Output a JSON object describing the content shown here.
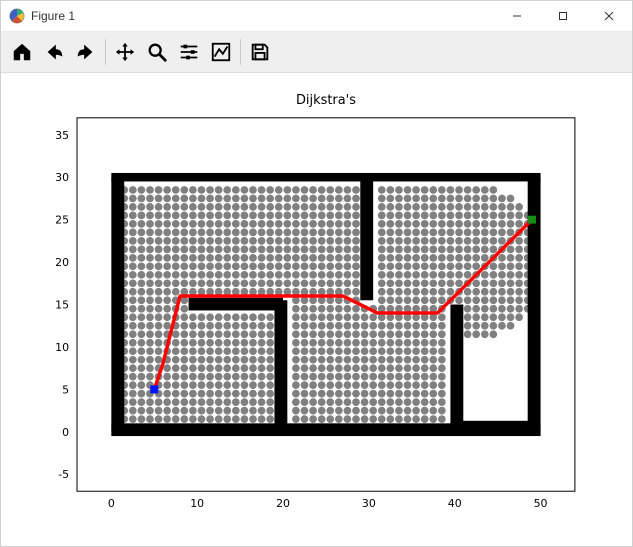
{
  "window": {
    "title": "Figure 1"
  },
  "toolbar": {
    "home_tip": "Home",
    "back_tip": "Back",
    "forward_tip": "Forward",
    "pan_tip": "Pan",
    "zoom_tip": "Zoom",
    "subplots_tip": "Configure subplots",
    "axes_tip": "Edit axis",
    "save_tip": "Save"
  },
  "chart_data": {
    "type": "scatter",
    "title": "Dijkstra's",
    "xlabel": "",
    "ylabel": "",
    "xlim": [
      -4,
      54
    ],
    "ylim": [
      -7,
      37
    ],
    "xticks": [
      0,
      10,
      20,
      30,
      40,
      50
    ],
    "yticks": [
      -5,
      0,
      5,
      10,
      15,
      20,
      25,
      30,
      35
    ],
    "obstacles_color": "#000000",
    "obstacles_rects": [
      {
        "x": 0,
        "y": -0.5,
        "w": 50,
        "h": 1.5
      },
      {
        "x": 0,
        "y": 29.5,
        "w": 50,
        "h": 1
      },
      {
        "x": 0,
        "y": 0,
        "w": 1.5,
        "h": 30
      },
      {
        "x": 48.5,
        "y": 0,
        "w": 1.5,
        "h": 30
      },
      {
        "x": 9,
        "y": 14.3,
        "w": 11,
        "h": 1.5
      },
      {
        "x": 19,
        "y": 0,
        "w": 1.5,
        "h": 15.5
      },
      {
        "x": 29,
        "y": 15.5,
        "w": 1.5,
        "h": 14.5
      },
      {
        "x": 39.5,
        "y": 0,
        "w": 1.5,
        "h": 15
      },
      {
        "x": 39.5,
        "y": 0,
        "w": 10,
        "h": 1.3
      }
    ],
    "start": {
      "x": 5,
      "y": 5,
      "color": "#0313ff"
    },
    "goal": {
      "x": 49,
      "y": 25,
      "color": "#158c17"
    },
    "path_color": "#ff0000",
    "path": [
      {
        "x": 5,
        "y": 5
      },
      {
        "x": 6,
        "y": 8
      },
      {
        "x": 8,
        "y": 16
      },
      {
        "x": 27,
        "y": 16
      },
      {
        "x": 31,
        "y": 14
      },
      {
        "x": 38,
        "y": 14
      },
      {
        "x": 49,
        "y": 25
      }
    ],
    "explored_color": "#808080",
    "explored_radius": 0.45,
    "explored": {
      "region": "grid",
      "x_start": 1.5,
      "x_end": 41,
      "y_start": 1.5,
      "y_end": 29,
      "exclude_rects": [
        {
          "x": 9,
          "y": 14.3,
          "w": 11,
          "h": 1.5
        },
        {
          "x": 19,
          "y": 0,
          "w": 1.5,
          "h": 15.5
        },
        {
          "x": 29,
          "y": 15.5,
          "w": 1.5,
          "h": 14.5
        },
        {
          "x": 39.5,
          "y": 0,
          "w": 1.5,
          "h": 15
        }
      ],
      "frontier_arc": {
        "cx": 41,
        "cy": 20,
        "r": 9.5,
        "y_min": 8.5,
        "y_max": 29,
        "x_max": 49
      }
    }
  }
}
